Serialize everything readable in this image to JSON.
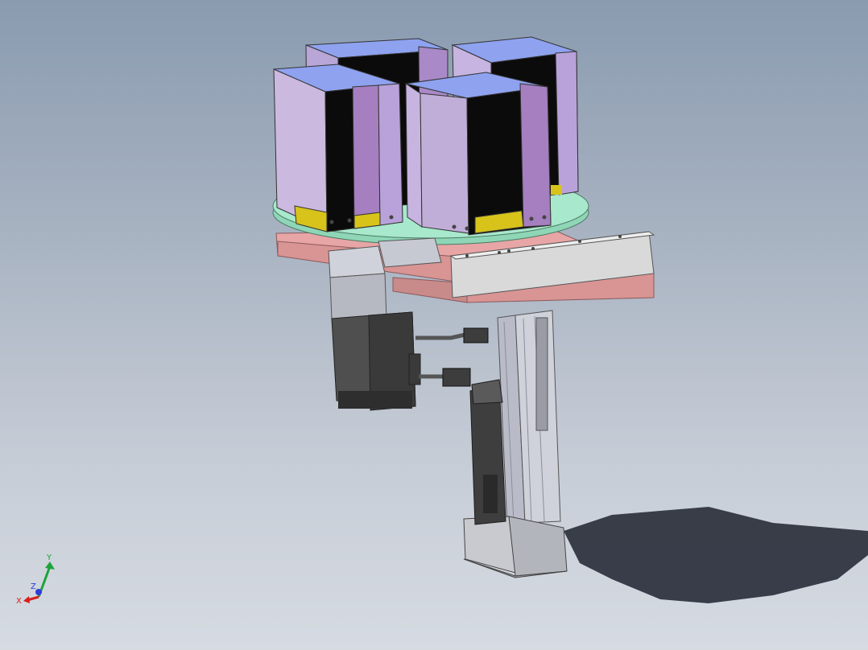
{
  "viewport": {
    "background_top": "#8a9bb0",
    "background_bottom": "#d6dbe2"
  },
  "model": {
    "description_colors": {
      "turntable": "#9fe0c3",
      "base_plate": "#e8a5a5",
      "magazine_side": "#b8a6d6",
      "magazine_top": "#8ea2f0",
      "magazine_inner": "#0b0b0b",
      "magazine_base_strip": "#d7c31a",
      "beam": "#d8d8d8",
      "motor": "#4d4d4d",
      "rail": "#c9c9d0",
      "shadow": "#2f3540"
    }
  },
  "triad": {
    "x_label": "X",
    "y_label": "Y",
    "z_label": "Z",
    "x_color": "#d81e1e",
    "y_color": "#1ea33a",
    "z_color": "#2d3bd8"
  }
}
